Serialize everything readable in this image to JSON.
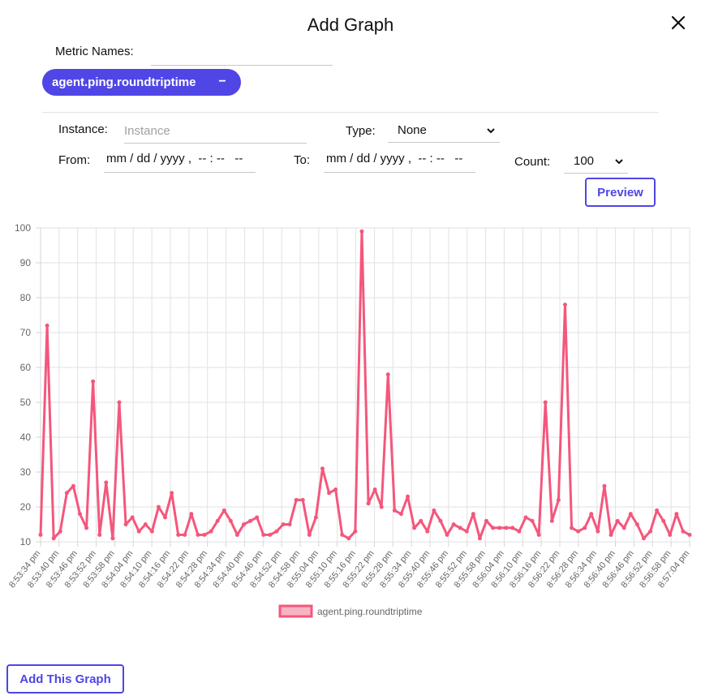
{
  "dialog": {
    "title": "Add Graph",
    "close_icon": "close-icon"
  },
  "metric_names": {
    "label": "Metric Names:",
    "value": "",
    "chips": [
      {
        "label": "agent.ping.roundtriptime",
        "remove_symbol": "−"
      }
    ]
  },
  "filters": {
    "instance_label": "Instance:",
    "instance_placeholder": "Instance",
    "type_label": "Type:",
    "type_value": "None",
    "from_label": "From:",
    "from_value": "mm / dd / yyyy ,  -- : --   --",
    "to_label": "To:",
    "to_value": "mm / dd / yyyy ,  -- : --   --",
    "count_label": "Count:",
    "count_value": "100",
    "preview_label": "Preview"
  },
  "chart_data": {
    "type": "line",
    "series": [
      {
        "name": "agent.ping.roundtriptime",
        "color": "#f4577c",
        "values": [
          12,
          72,
          11,
          13,
          24,
          26,
          18,
          14,
          56,
          12,
          27,
          11,
          50,
          15,
          17,
          13,
          15,
          13,
          20,
          17,
          24,
          12,
          12,
          18,
          12,
          12,
          13,
          16,
          19,
          16,
          12,
          15,
          16,
          17,
          12,
          12,
          13,
          15,
          15,
          22,
          22,
          12,
          17,
          31,
          24,
          25,
          12,
          11,
          13,
          99,
          21,
          25,
          20,
          58,
          19,
          18,
          23,
          14,
          16,
          13,
          19,
          16,
          12,
          15,
          14,
          13,
          18,
          11,
          16,
          14,
          14,
          14,
          14,
          13,
          17,
          16,
          12,
          50,
          16,
          22,
          78,
          14,
          13,
          14,
          18,
          13,
          26,
          12,
          16,
          14,
          18,
          15,
          11,
          13,
          19,
          16,
          12,
          18,
          13,
          12
        ]
      }
    ],
    "x_tick_labels": [
      "8:53:34 pm",
      "8:53:40 pm",
      "8:53:46 pm",
      "8:53:52 pm",
      "8:53:58 pm",
      "8:54:04 pm",
      "8:54:10 pm",
      "8:54:16 pm",
      "8:54:22 pm",
      "8:54:28 pm",
      "8:54:34 pm",
      "8:54:40 pm",
      "8:54:46 pm",
      "8:54:52 pm",
      "8:54:58 pm",
      "8:55:04 pm",
      "8:55:10 pm",
      "8:55:16 pm",
      "8:55:22 pm",
      "8:55:28 pm",
      "8:55:34 pm",
      "8:55:40 pm",
      "8:55:46 pm",
      "8:55:52 pm",
      "8:55:58 pm",
      "8:56:04 pm",
      "8:56:10 pm",
      "8:56:16 pm",
      "8:56:22 pm",
      "8:56:28 pm",
      "8:56:34 pm",
      "8:56:40 pm",
      "8:56:46 pm",
      "8:56:52 pm",
      "8:56:58 pm",
      "8:57:04 pm"
    ],
    "ylim": [
      10,
      100
    ],
    "y_ticks": [
      100,
      90,
      80,
      70,
      60,
      50,
      40,
      30,
      20,
      10
    ],
    "grid": true,
    "legend_position": "bottom-center",
    "title": "",
    "xlabel": "",
    "ylabel": ""
  },
  "footer": {
    "add_button_label": "Add This Graph"
  },
  "colors": {
    "accent": "#4f46e5",
    "series": "#f4577c",
    "series_fill": "#f9b3c2"
  }
}
